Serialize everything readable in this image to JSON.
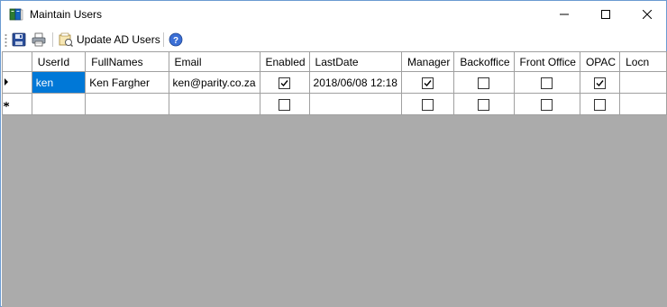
{
  "window": {
    "title": "Maintain Users",
    "accent": "#0078d7"
  },
  "toolbar": {
    "save_icon": "save-icon",
    "print_icon": "print-icon",
    "update_label": "Update AD Users",
    "help_icon": "help-icon"
  },
  "grid": {
    "columns": [
      "UserId",
      "FullNames",
      "Email",
      "Enabled",
      "LastDate",
      "Manager",
      "Backoffice",
      "Front Office",
      "OPAC",
      "Locn"
    ],
    "rows": [
      {
        "indicator": "current-row-arrow",
        "userid": "ken",
        "fullnames": "Ken Fargher",
        "email": "ken@parity.co.za",
        "enabled": true,
        "lastdate": "2018/06/08 12:18",
        "manager": true,
        "backoffice": false,
        "frontoffice": false,
        "opac": true,
        "locn": ""
      },
      {
        "indicator": "new-row-star",
        "userid": "",
        "fullnames": "",
        "email": "",
        "enabled": false,
        "lastdate": "",
        "manager": false,
        "backoffice": false,
        "frontoffice": false,
        "opac": false,
        "locn": ""
      }
    ]
  }
}
